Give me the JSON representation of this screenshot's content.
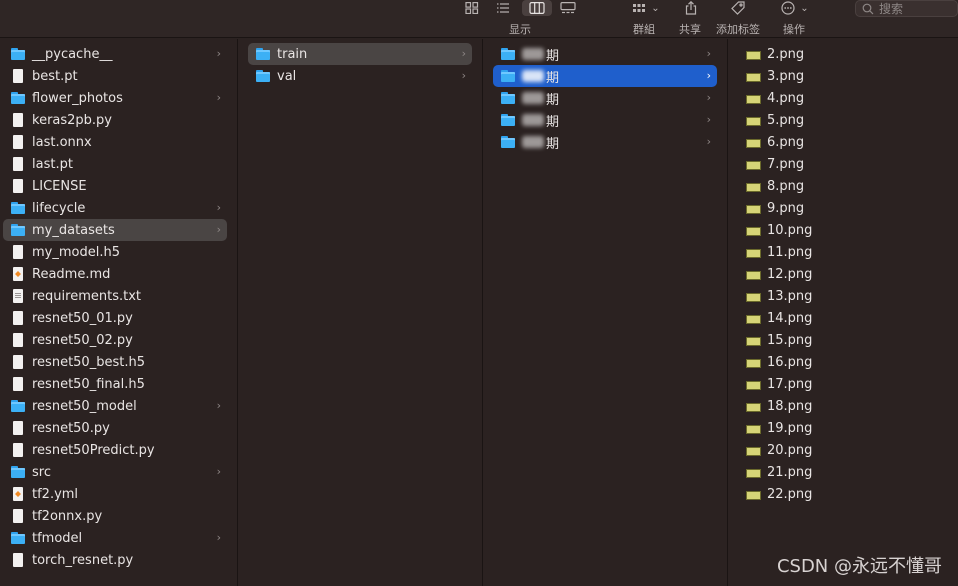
{
  "toolbar": {
    "display_label": "显示",
    "group_label": "群組",
    "share_label": "共享",
    "add_tag_label": "添加标签",
    "action_label": "操作",
    "search_placeholder": "搜索"
  },
  "column1": {
    "items": [
      {
        "name": "__pycache__",
        "kind": "folder",
        "chevron": "›"
      },
      {
        "name": "best.pt",
        "kind": "file"
      },
      {
        "name": "flower_photos",
        "kind": "folder",
        "chevron": "›"
      },
      {
        "name": "keras2pb.py",
        "kind": "file"
      },
      {
        "name": "last.onnx",
        "kind": "file"
      },
      {
        "name": "last.pt",
        "kind": "file"
      },
      {
        "name": "LICENSE",
        "kind": "file"
      },
      {
        "name": "lifecycle",
        "kind": "folder",
        "chevron": "›"
      },
      {
        "name": "my_datasets",
        "kind": "folder",
        "chevron": "›",
        "selected": "gray"
      },
      {
        "name": "my_model.h5",
        "kind": "file"
      },
      {
        "name": "Readme.md",
        "kind": "md"
      },
      {
        "name": "requirements.txt",
        "kind": "text"
      },
      {
        "name": "resnet50_01.py",
        "kind": "file"
      },
      {
        "name": "resnet50_02.py",
        "kind": "file"
      },
      {
        "name": "resnet50_best.h5",
        "kind": "file"
      },
      {
        "name": "resnet50_final.h5",
        "kind": "file"
      },
      {
        "name": "resnet50_model",
        "kind": "folder",
        "chevron": "›"
      },
      {
        "name": "resnet50.py",
        "kind": "file"
      },
      {
        "name": "resnet50Predict.py",
        "kind": "file"
      },
      {
        "name": "src",
        "kind": "folder",
        "chevron": "›"
      },
      {
        "name": "tf2.yml",
        "kind": "yml"
      },
      {
        "name": "tf2onnx.py",
        "kind": "file"
      },
      {
        "name": "tfmodel",
        "kind": "folder",
        "chevron": "›"
      },
      {
        "name": "torch_resnet.py",
        "kind": "file"
      }
    ]
  },
  "column2": {
    "items": [
      {
        "name": "train",
        "kind": "folder",
        "chevron": "›",
        "selected": "gray"
      },
      {
        "name": "val",
        "kind": "folder",
        "chevron": "›"
      }
    ]
  },
  "column3": {
    "items": [
      {
        "name": "期",
        "kind": "folder",
        "chevron": "›"
      },
      {
        "name": "期",
        "kind": "folder",
        "chevron": "›",
        "selected": "blue"
      },
      {
        "name": "期",
        "kind": "folder",
        "chevron": "›"
      },
      {
        "name": "期",
        "kind": "folder",
        "chevron": "›"
      },
      {
        "name": "期",
        "kind": "folder",
        "chevron": "›"
      }
    ]
  },
  "column4": {
    "items": [
      {
        "name": "2.png"
      },
      {
        "name": "3.png"
      },
      {
        "name": "4.png"
      },
      {
        "name": "5.png"
      },
      {
        "name": "6.png"
      },
      {
        "name": "7.png"
      },
      {
        "name": "8.png"
      },
      {
        "name": "9.png"
      },
      {
        "name": "10.png"
      },
      {
        "name": "11.png"
      },
      {
        "name": "12.png"
      },
      {
        "name": "13.png"
      },
      {
        "name": "14.png"
      },
      {
        "name": "15.png"
      },
      {
        "name": "16.png"
      },
      {
        "name": "17.png"
      },
      {
        "name": "18.png"
      },
      {
        "name": "19.png"
      },
      {
        "name": "20.png"
      },
      {
        "name": "21.png"
      },
      {
        "name": "22.png"
      }
    ]
  },
  "watermark": "CSDN @永远不懂哥",
  "colors": {
    "background": "#2b2221",
    "selection_blue": "#1f5fcc",
    "selection_gray": "#4a4544",
    "folder": "#3cb0f5"
  }
}
